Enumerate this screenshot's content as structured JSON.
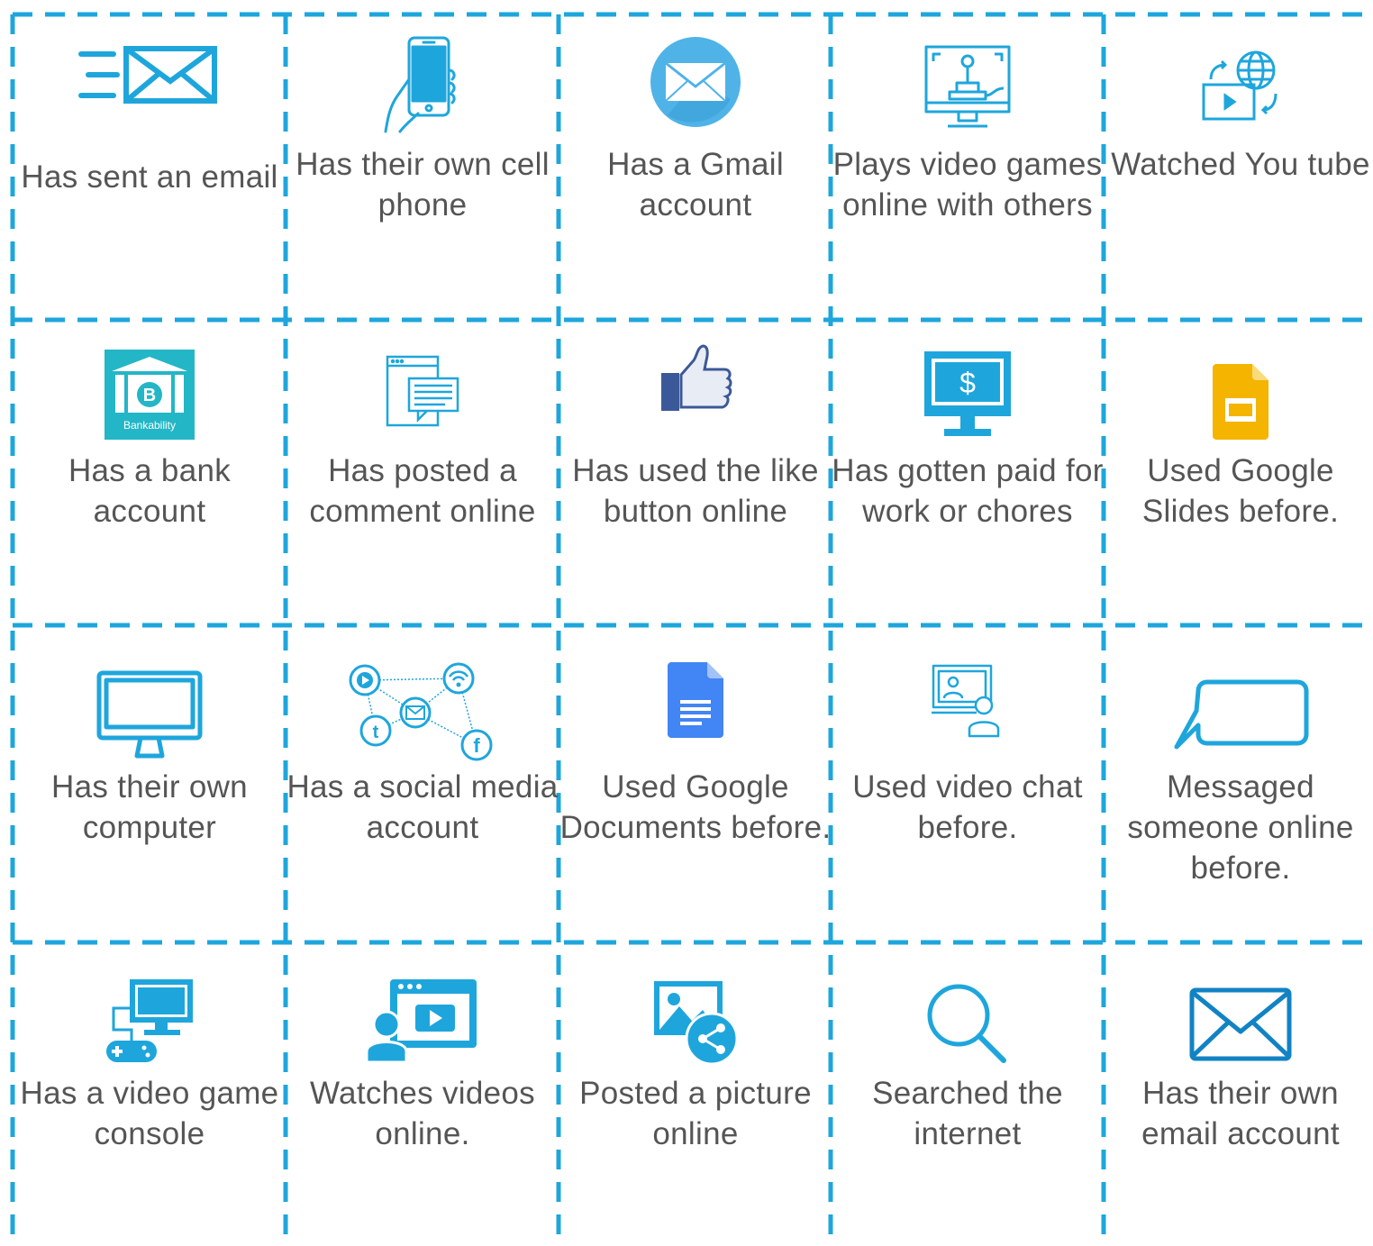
{
  "colors": {
    "grid": "#1ea6dc",
    "text": "#555555",
    "icon": "#1ea6dc",
    "icon_dark": "#1183c4"
  },
  "cells": [
    {
      "label": "Has sent an email",
      "icon": "fast-mail-icon"
    },
    {
      "label": "Has their own cell phone",
      "icon": "hand-phone-icon"
    },
    {
      "label": "Has a Gmail account",
      "icon": "mail-circle-icon"
    },
    {
      "label": "Plays video games online with others",
      "icon": "arcade-monitor-icon"
    },
    {
      "label": "Watched You tube",
      "icon": "video-globe-icon"
    },
    {
      "label": "Has a bank account",
      "icon": "bank-icon",
      "logo_text": "Bankability"
    },
    {
      "label": "Has posted a comment online",
      "icon": "comment-page-icon"
    },
    {
      "label": "Has used the like button online",
      "icon": "thumbs-up-icon"
    },
    {
      "label": "Has gotten paid for work or chores",
      "icon": "dollar-monitor-icon",
      "icon_text": "$"
    },
    {
      "label": "Used Google Slides before.",
      "icon": "google-slides-icon"
    },
    {
      "label": "Has their own computer",
      "icon": "monitor-icon"
    },
    {
      "label": "Has a social media account",
      "icon": "social-network-icon"
    },
    {
      "label": "Used Google Documents before.",
      "icon": "google-docs-icon"
    },
    {
      "label": "Used video chat before.",
      "icon": "video-chat-icon"
    },
    {
      "label": "Messaged someone online before.",
      "icon": "speech-bubble-icon"
    },
    {
      "label": "Has a video game console",
      "icon": "game-console-icon"
    },
    {
      "label": "Watches videos online.",
      "icon": "video-viewer-icon"
    },
    {
      "label": "Posted a picture online",
      "icon": "share-picture-icon"
    },
    {
      "label": "Searched the internet",
      "icon": "magnifier-icon"
    },
    {
      "label": "Has their own email account",
      "icon": "envelope-icon"
    }
  ]
}
